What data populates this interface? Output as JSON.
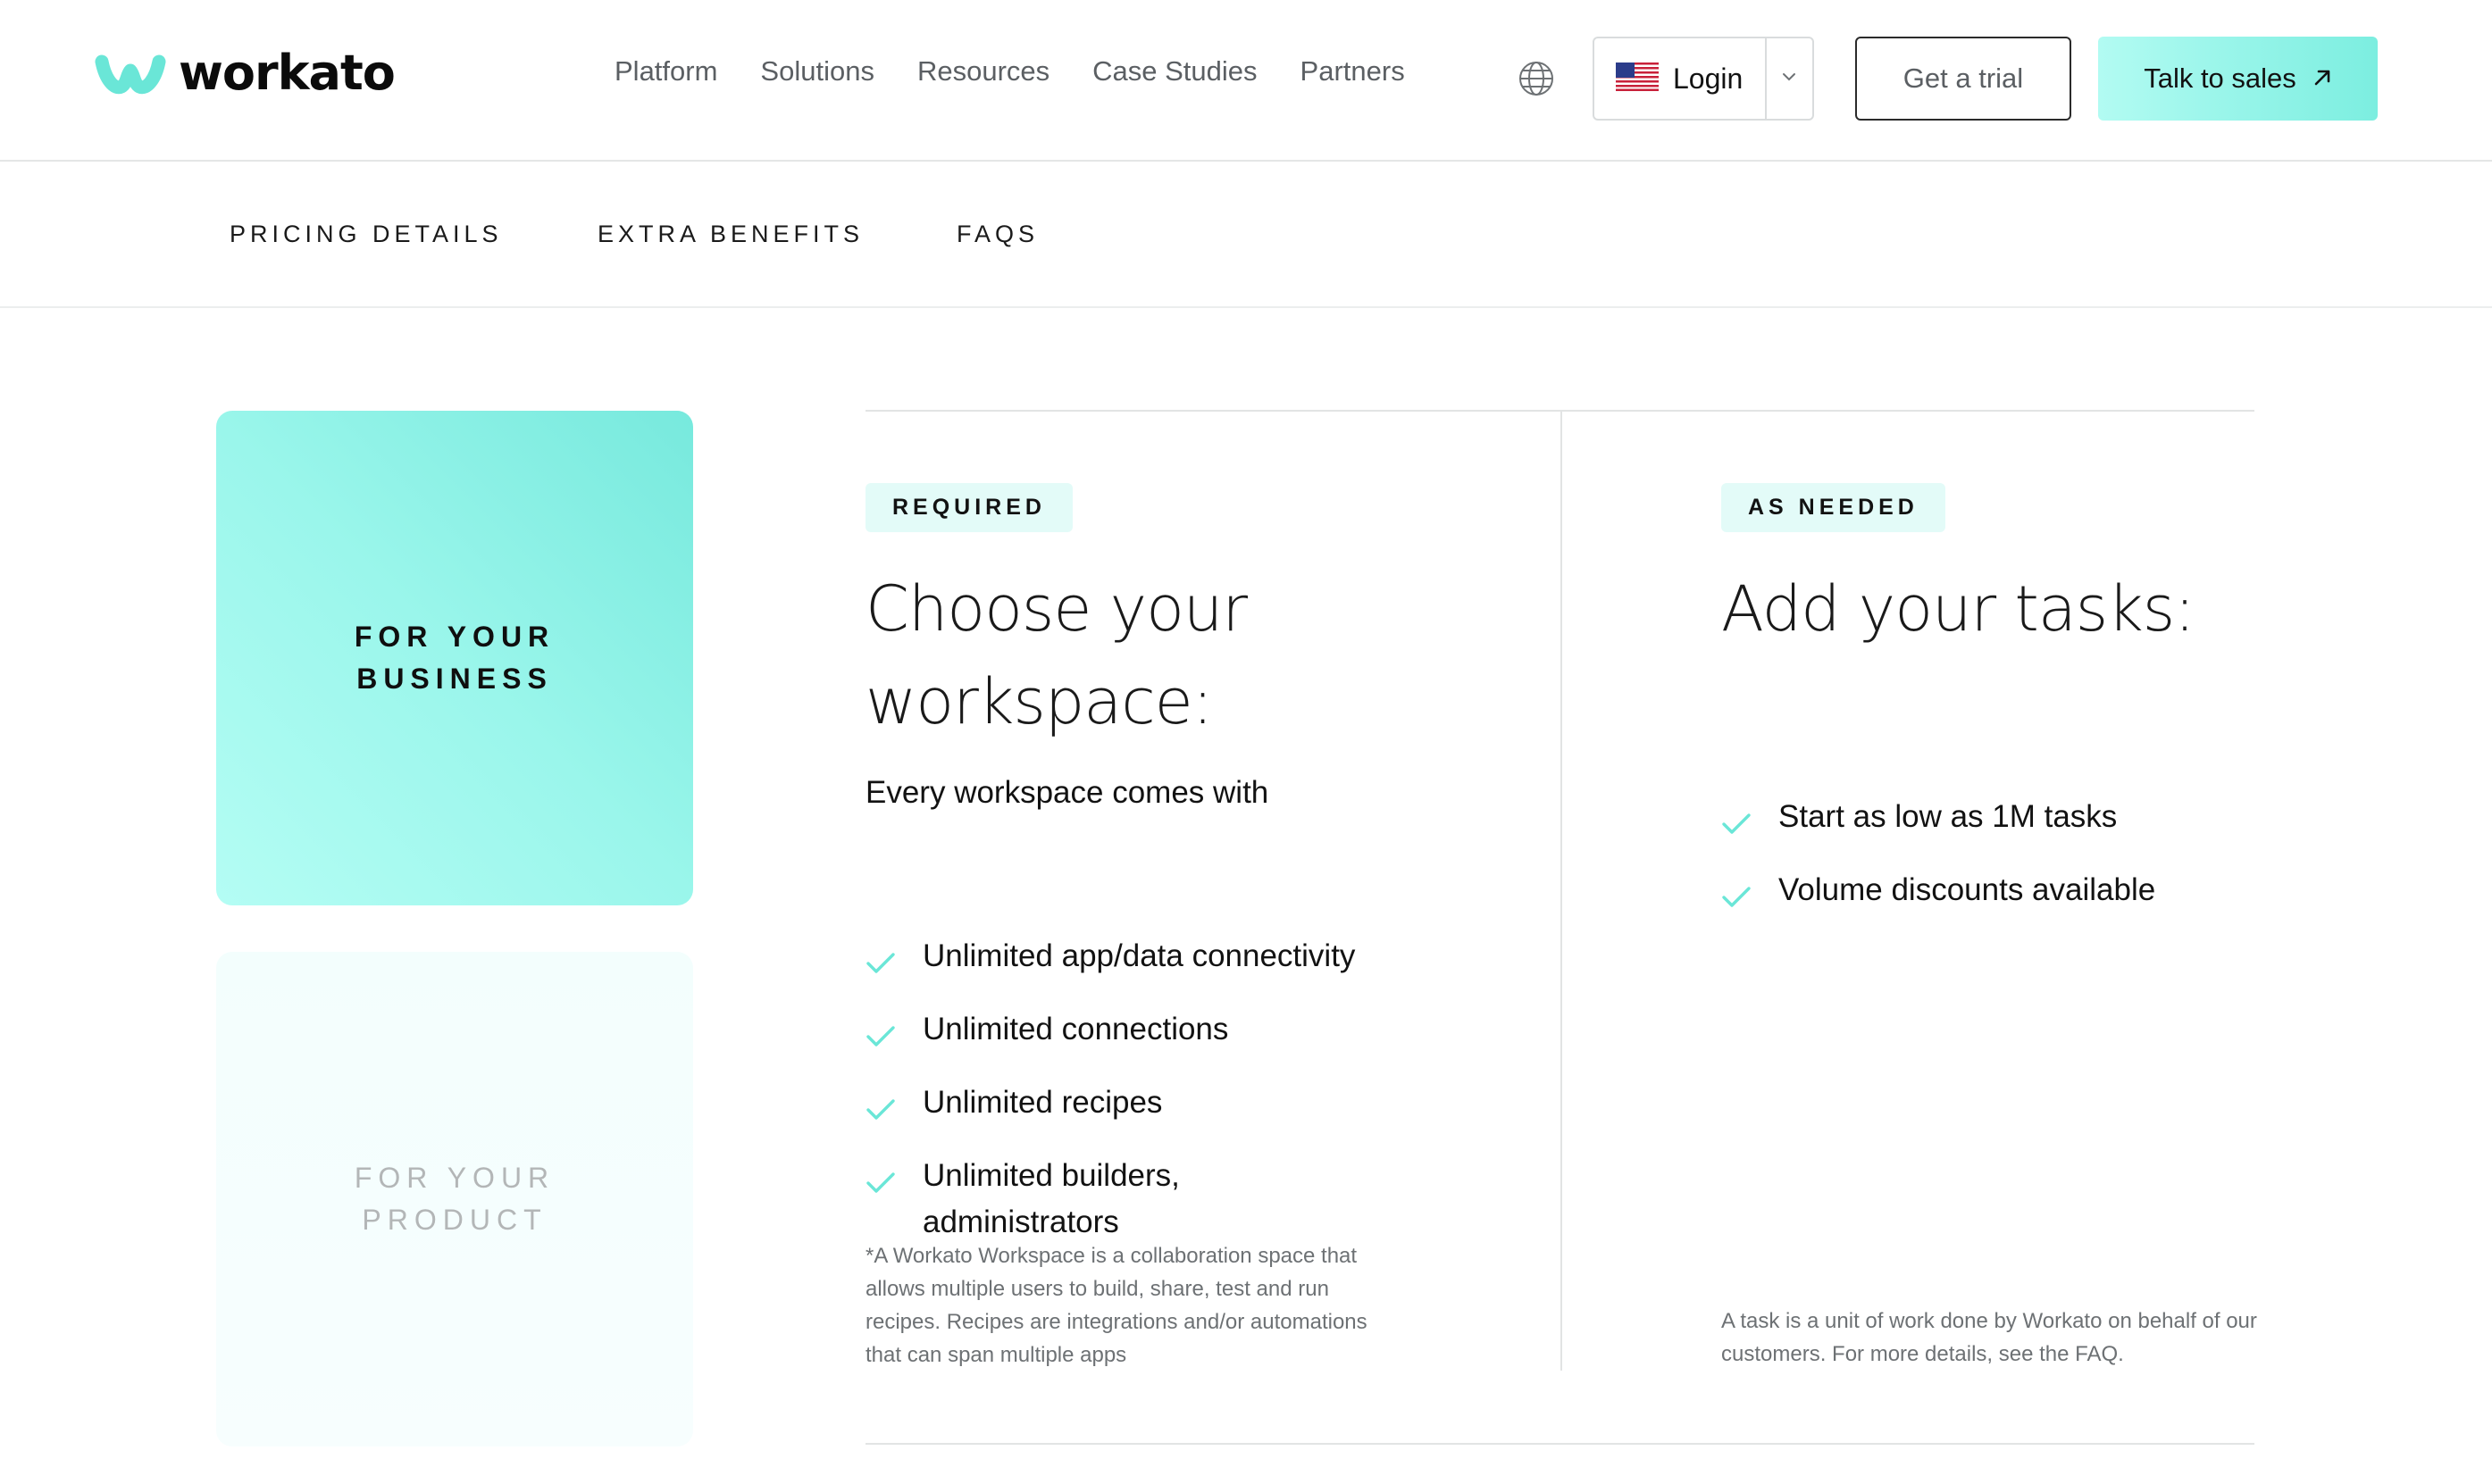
{
  "brand": {
    "name": "workato",
    "accent": "#6ae6d7"
  },
  "nav": {
    "items": [
      {
        "id": "platform",
        "label": "Platform"
      },
      {
        "id": "solutions",
        "label": "Solutions"
      },
      {
        "id": "resources",
        "label": "Resources"
      },
      {
        "id": "case-studies",
        "label": "Case Studies"
      },
      {
        "id": "partners",
        "label": "Partners"
      }
    ],
    "globe_icon": "globe-icon",
    "login": {
      "label": "Login",
      "flag_icon": "us-flag-icon",
      "dropdown_icon": "chevron-down-icon"
    },
    "trial_label": "Get a trial",
    "sales_label": "Talk to sales",
    "sales_icon": "arrow-up-right-icon"
  },
  "subnav": {
    "items": [
      {
        "id": "pricing-details",
        "label": "PRICING DETAILS"
      },
      {
        "id": "extra-benefits",
        "label": "EXTRA BENEFITS"
      },
      {
        "id": "faqs",
        "label": "FAQS"
      }
    ]
  },
  "cards": {
    "business": {
      "line1": "FOR YOUR",
      "line2": "BUSINESS",
      "active": true
    },
    "product": {
      "line1": "FOR YOUR",
      "line2": "PRODUCT",
      "active": false
    }
  },
  "workspace": {
    "badge": "REQUIRED",
    "heading_line1": "Choose your",
    "heading_line2": "workspace:",
    "intro": "Every workspace comes with",
    "features": [
      {
        "line1": "Unlimited app/data connectivity"
      },
      {
        "line1": "Unlimited connections"
      },
      {
        "line1": "Unlimited recipes"
      },
      {
        "line1": "Unlimited builders,",
        "line2": "administrators"
      }
    ],
    "footnote": "*A Workato Workspace is a collaboration space that allows multiple users to build, share, test and run recipes. Recipes are integrations and/or automations that can span multiple apps"
  },
  "tasks": {
    "badge": "AS NEEDED",
    "heading": "Add your tasks:",
    "features": [
      {
        "line1": "Start as low as 1M tasks"
      },
      {
        "line1": "Volume discounts available"
      }
    ],
    "footnote": "A task is a unit of work done by Workato on behalf of our customers. For more details, see the FAQ."
  }
}
